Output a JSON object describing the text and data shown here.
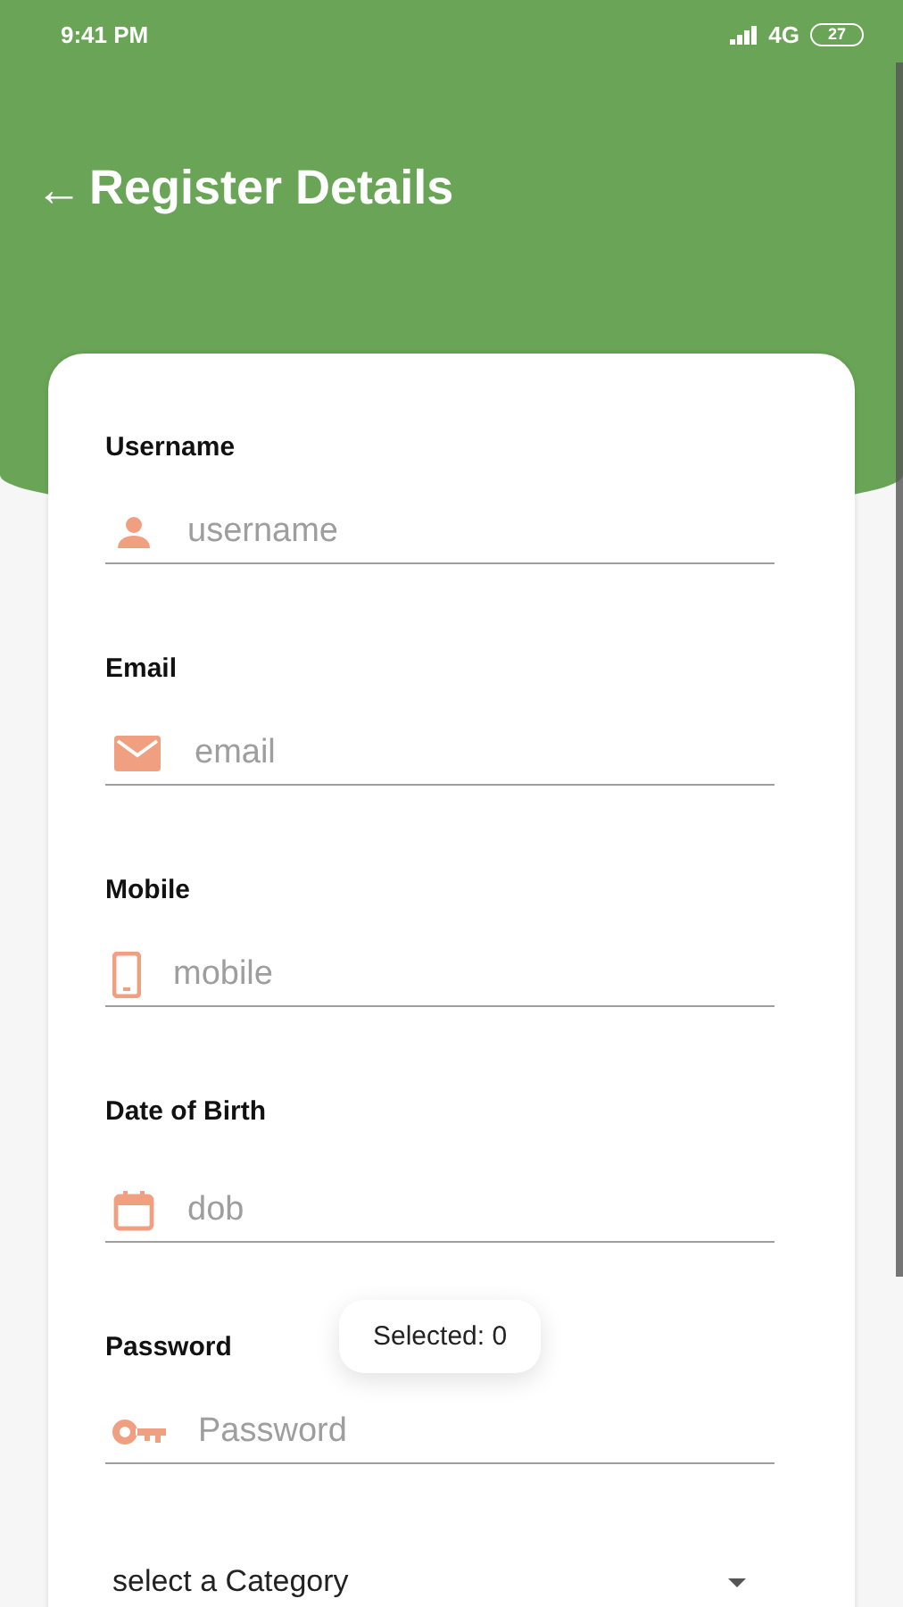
{
  "status_bar": {
    "time": "9:41 PM",
    "network": "4G",
    "battery": "27"
  },
  "header": {
    "back": "←",
    "title": "Register Details"
  },
  "fields": [
    {
      "label": "Username",
      "kind": "person",
      "placeholder": "username"
    },
    {
      "label": "Email",
      "kind": "mail",
      "placeholder": "email"
    },
    {
      "label": "Mobile",
      "kind": "phone",
      "placeholder": "mobile"
    },
    {
      "label": "Date of Birth",
      "kind": "calendar",
      "placeholder": "dob"
    },
    {
      "label": "Password",
      "kind": "key",
      "placeholder": "Password"
    }
  ],
  "dropdown": {
    "placeholder": "select a Category"
  },
  "toast": {
    "text": "Selected: 0"
  }
}
